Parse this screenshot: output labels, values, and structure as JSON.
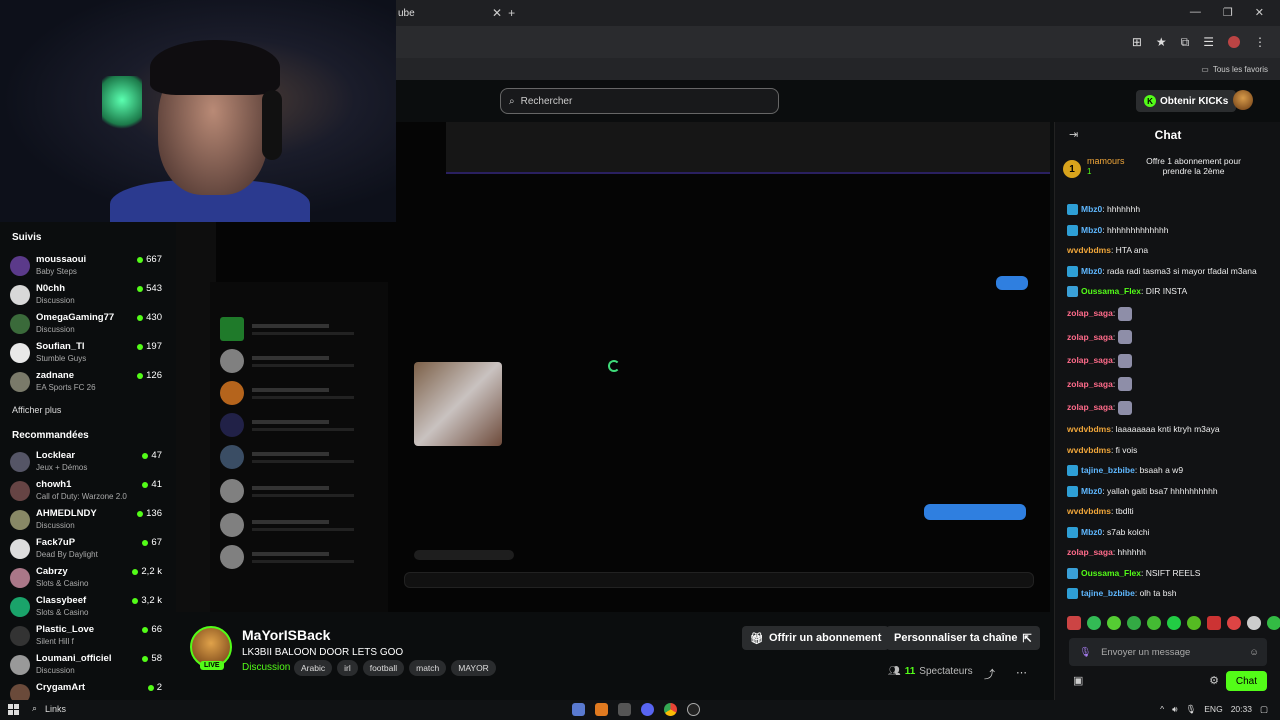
{
  "browser": {
    "tab_fragment": "ube",
    "bookmark_all": "Tous les favoris"
  },
  "header": {
    "search_placeholder": "Rechercher",
    "get_kicks": "Obtenir KICKs"
  },
  "sidebar": {
    "followed_title": "Suivis",
    "followed": [
      {
        "name": "moussaoui",
        "game": "Baby Steps",
        "viewers": "667"
      },
      {
        "name": "N0chh",
        "game": "Discussion",
        "viewers": "543"
      },
      {
        "name": "OmegaGaming77",
        "game": "Discussion",
        "viewers": "430"
      },
      {
        "name": "Soufian_Tl",
        "game": "Stumble Guys",
        "viewers": "197"
      },
      {
        "name": "zadnane",
        "game": "EA Sports FC 26",
        "viewers": "126"
      }
    ],
    "show_more": "Afficher plus",
    "recommended_title": "Recommandées",
    "recommended": [
      {
        "name": "Locklear",
        "game": "Jeux + Démos",
        "viewers": "47"
      },
      {
        "name": "chowh1",
        "game": "Call of Duty: Warzone 2.0",
        "viewers": "41"
      },
      {
        "name": "AHMEDLNDY",
        "game": "Discussion",
        "viewers": "136"
      },
      {
        "name": "Fack7uP",
        "game": "Dead By Daylight",
        "viewers": "67"
      },
      {
        "name": "Cabrzy",
        "game": "Slots & Casino",
        "viewers": "2,2 k"
      },
      {
        "name": "Classybeef",
        "game": "Slots & Casino",
        "viewers": "3,2 k"
      },
      {
        "name": "Plastic_Love",
        "game": "Silent Hill f",
        "viewers": "66"
      },
      {
        "name": "Loumani_officiel",
        "game": "Discussion",
        "viewers": "58"
      },
      {
        "name": "CrygamArt",
        "game": "",
        "viewers": "2"
      }
    ]
  },
  "stream": {
    "streamer": "MaYorISBack",
    "title": "LK3BII BALOON DOOR LETS GOO",
    "category": "Discussion",
    "tags": [
      "Arabic",
      "irl",
      "football",
      "match",
      "MAYOR"
    ],
    "live": "LIVE",
    "subscribe": "Offrir un abonnement",
    "customize": "Personnaliser ta chaîne",
    "viewer_count": "11",
    "viewer_label": "Spectateurs"
  },
  "chat": {
    "title": "Chat",
    "pinned_user": "mamours",
    "pinned_count": "1",
    "pinned_rank": "1",
    "pinned_text": "Offre 1 abonnement pour prendre la 2ème",
    "messages": [
      {
        "user": "Mbz0",
        "color": "#5fb8ff",
        "text": ": hhhhhhh"
      },
      {
        "user": "Mbz0",
        "color": "#5fb8ff",
        "text": ": hhhhhhhhhhhhh"
      },
      {
        "user": "wvdvbdms",
        "color": "#f0a63a",
        "text": ": HTA ana"
      },
      {
        "user": "Mbz0",
        "color": "#5fb8ff",
        "text": ": rada radi tasma3 si mayor tfadal m3ana"
      },
      {
        "user": "Oussama_Flex",
        "color": "#53fc18",
        "text": ": DIR INSTA"
      },
      {
        "user": "zolap_saga",
        "color": "#ff6b8a",
        "text": ":"
      },
      {
        "user": "zolap_saga",
        "color": "#ff6b8a",
        "text": ":"
      },
      {
        "user": "zolap_saga",
        "color": "#ff6b8a",
        "text": ":"
      },
      {
        "user": "zolap_saga",
        "color": "#ff6b8a",
        "text": ":"
      },
      {
        "user": "zolap_saga",
        "color": "#ff6b8a",
        "text": ":"
      },
      {
        "user": "wvdvbdms",
        "color": "#f0a63a",
        "text": ": laaaaaaaa knti ktryh m3aya"
      },
      {
        "user": "wvdvbdms",
        "color": "#f0a63a",
        "text": ": fi vois"
      },
      {
        "user": "tajine_bzbibe",
        "color": "#5fb8ff",
        "text": ": bsaah a w9"
      },
      {
        "user": "Mbz0",
        "color": "#5fb8ff",
        "text": ": yallah galti bsa7 hhhhhhhhhh"
      },
      {
        "user": "wvdvbdms",
        "color": "#f0a63a",
        "text": ": tbdlti"
      },
      {
        "user": "Mbz0",
        "color": "#5fb8ff",
        "text": ": s7ab kolchi"
      },
      {
        "user": "zolap_saga",
        "color": "#ff6b8a",
        "text": ": hhhhhh"
      },
      {
        "user": "Oussama_Flex",
        "color": "#53fc18",
        "text": ": NSIFT REELS"
      },
      {
        "user": "tajine_bzbibe",
        "color": "#5fb8ff",
        "text": ": olh ta bsh"
      }
    ],
    "input_placeholder": "Envoyer un message",
    "send": "Chat"
  },
  "taskbar": {
    "search_label": "Links",
    "lang": "ENG",
    "time": "20:33"
  }
}
